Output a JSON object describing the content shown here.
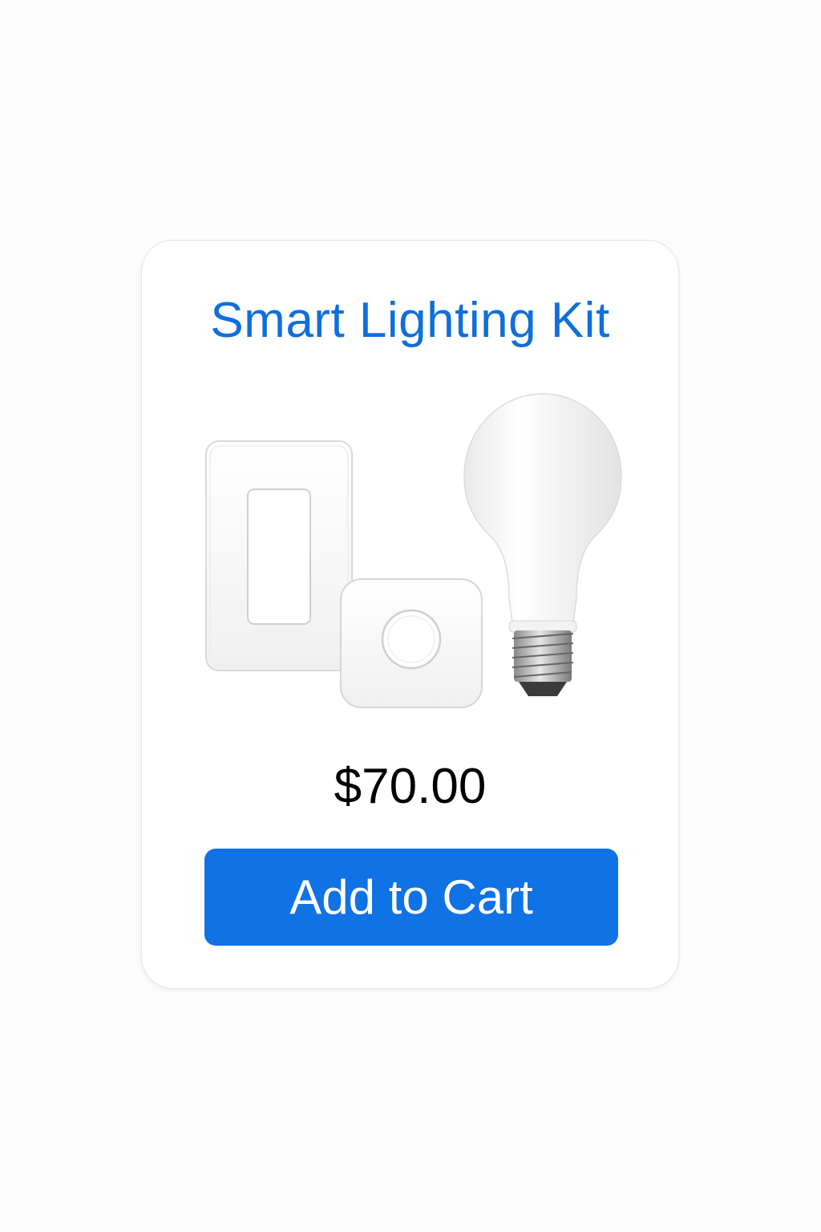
{
  "product": {
    "title": "Smart Lighting Kit",
    "price": "$70.00",
    "cta_label": "Add to Cart",
    "image_items": [
      "light-switch",
      "smart-hub",
      "light-bulb"
    ]
  },
  "colors": {
    "title": "#0f6fdc",
    "button_bg": "#0f72e5",
    "button_text": "#ffffff",
    "price_text": "#000000",
    "card_bg": "#ffffff",
    "page_bg": "#fcfcfc"
  }
}
